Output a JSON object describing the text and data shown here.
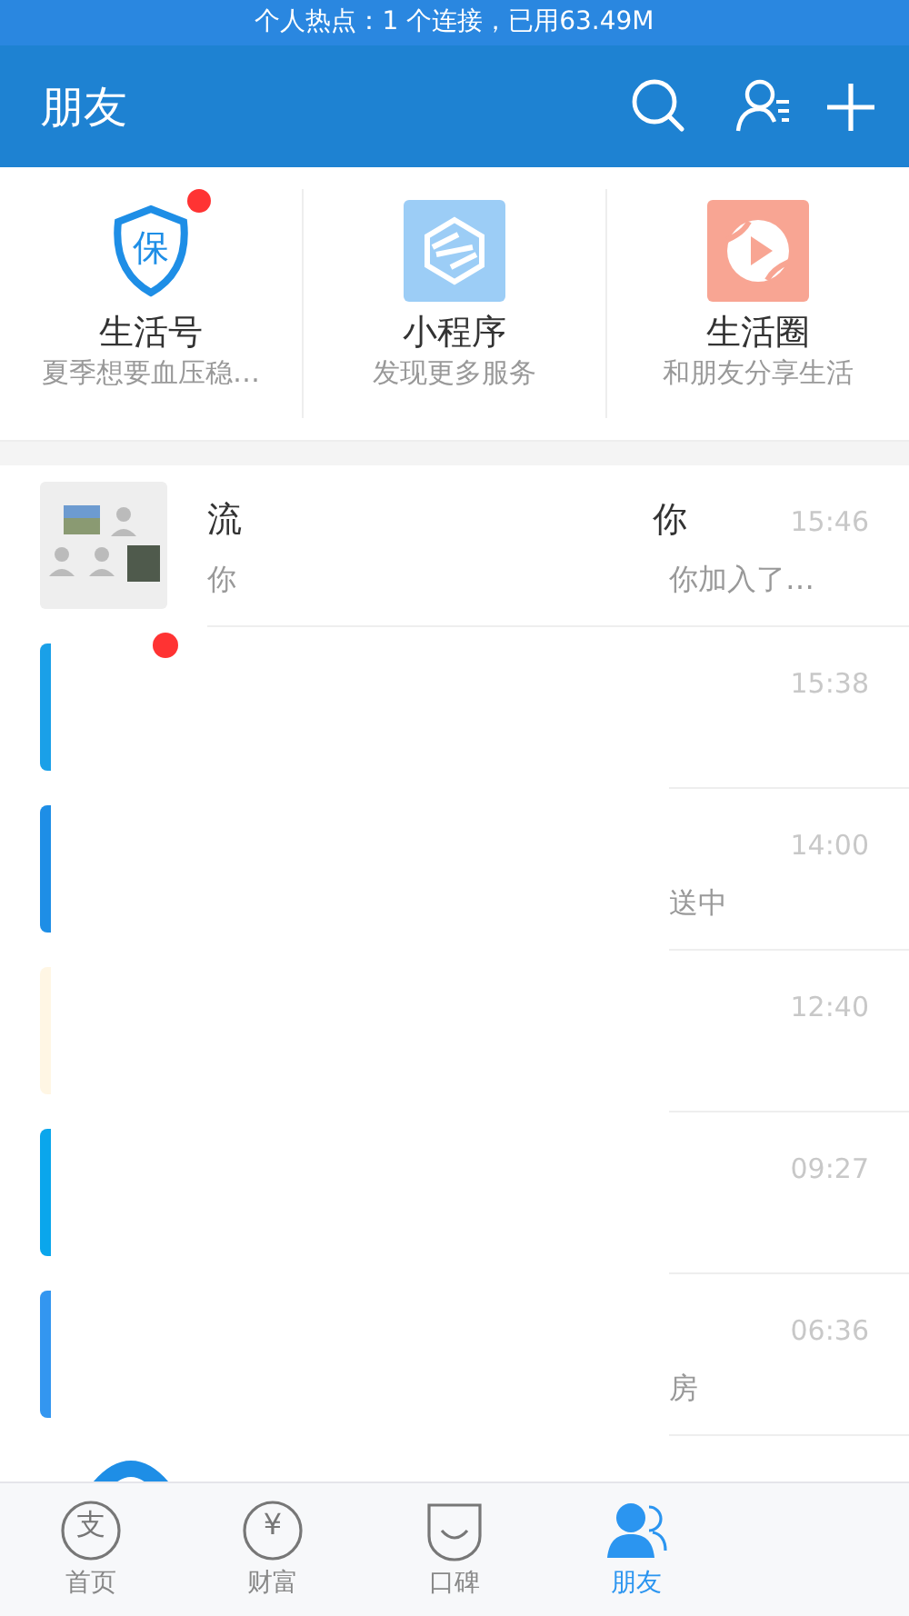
{
  "status_bar": {
    "text": "个人热点：1 个连接，已用63.49M"
  },
  "header": {
    "title": "朋友"
  },
  "shortcuts": [
    {
      "kind": "shield",
      "glyph": "保",
      "title": "生活号",
      "subtitle": "夏季想要血压稳…",
      "unread": true
    },
    {
      "kind": "hexagon",
      "title": "小程序",
      "subtitle": "发现更多服务",
      "unread": false
    },
    {
      "kind": "play",
      "title": "生活圈",
      "subtitle": "和朋友分享生活",
      "unread": false
    }
  ],
  "chats": [
    {
      "kind": "group",
      "title": "流",
      "title_end": "你",
      "preview": "你",
      "preview_end": "你加入了…",
      "time": "15:46",
      "unread": false
    },
    {
      "kind": "sliver",
      "color": "#1aa0e8",
      "time": "15:38",
      "unread": true
    },
    {
      "kind": "sliver",
      "color": "#1e8ee6",
      "preview_end": "送中",
      "time": "14:00",
      "unread": false
    },
    {
      "kind": "sliver",
      "color": "#fff6e4",
      "time": "12:40",
      "unread": false
    },
    {
      "kind": "sliver",
      "color": "#0aa6ec",
      "time": "09:27",
      "unread": false
    },
    {
      "kind": "sliver",
      "color": "#3396f0",
      "preview_end": "房",
      "time": "06:36",
      "unread": false
    },
    {
      "kind": "signal"
    }
  ],
  "tab_bar": [
    {
      "kind": "home",
      "glyph": "支",
      "label": "首页",
      "selected": false
    },
    {
      "kind": "wealth",
      "glyph": "¥",
      "label": "财富",
      "selected": false
    },
    {
      "kind": "koubei",
      "label": "口碑",
      "selected": false
    },
    {
      "kind": "friends",
      "label": "朋友",
      "selected": true
    }
  ]
}
